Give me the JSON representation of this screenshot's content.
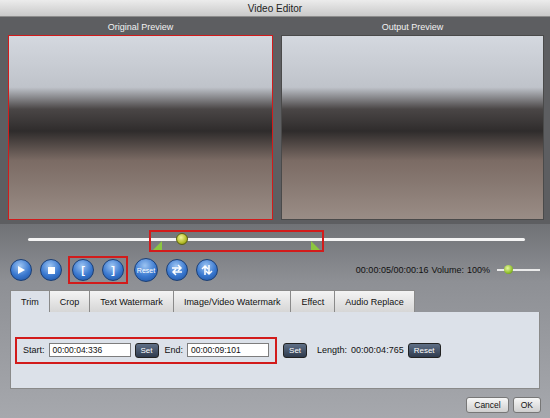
{
  "window": {
    "title": "Video Editor"
  },
  "previews": [
    {
      "label": "Original Preview"
    },
    {
      "label": "Output Preview"
    }
  ],
  "timeline": {
    "level": 0.31,
    "trim_start": 0.27,
    "trim_end": 0.57
  },
  "controls": {
    "mark_in": "[",
    "mark_out": "]",
    "reset": "Reset"
  },
  "time": "00:00:05/00:00:16",
  "volume": {
    "label": "Volume:",
    "reading": "100%",
    "level": 0.25
  },
  "tabs": [
    {
      "label": "Trim",
      "selected": true
    },
    {
      "label": "Crop",
      "selected": false
    },
    {
      "label": "Text Watermark",
      "selected": false
    },
    {
      "label": "Image/Video Watermark",
      "selected": false
    },
    {
      "label": "Effect",
      "selected": false
    },
    {
      "label": "Audio Replace",
      "selected": false
    }
  ],
  "trim": {
    "start_label": "Start:",
    "start": "00:00:04:336",
    "start_set": "Set",
    "end_label": "End:",
    "end": "00:00:09:101",
    "end_set": "Set",
    "length_label": "Length:",
    "length": "00:00:04:765",
    "reset": "Reset"
  },
  "buttons": [
    {
      "label": "Cancel"
    },
    {
      "label": "OK"
    }
  ]
}
